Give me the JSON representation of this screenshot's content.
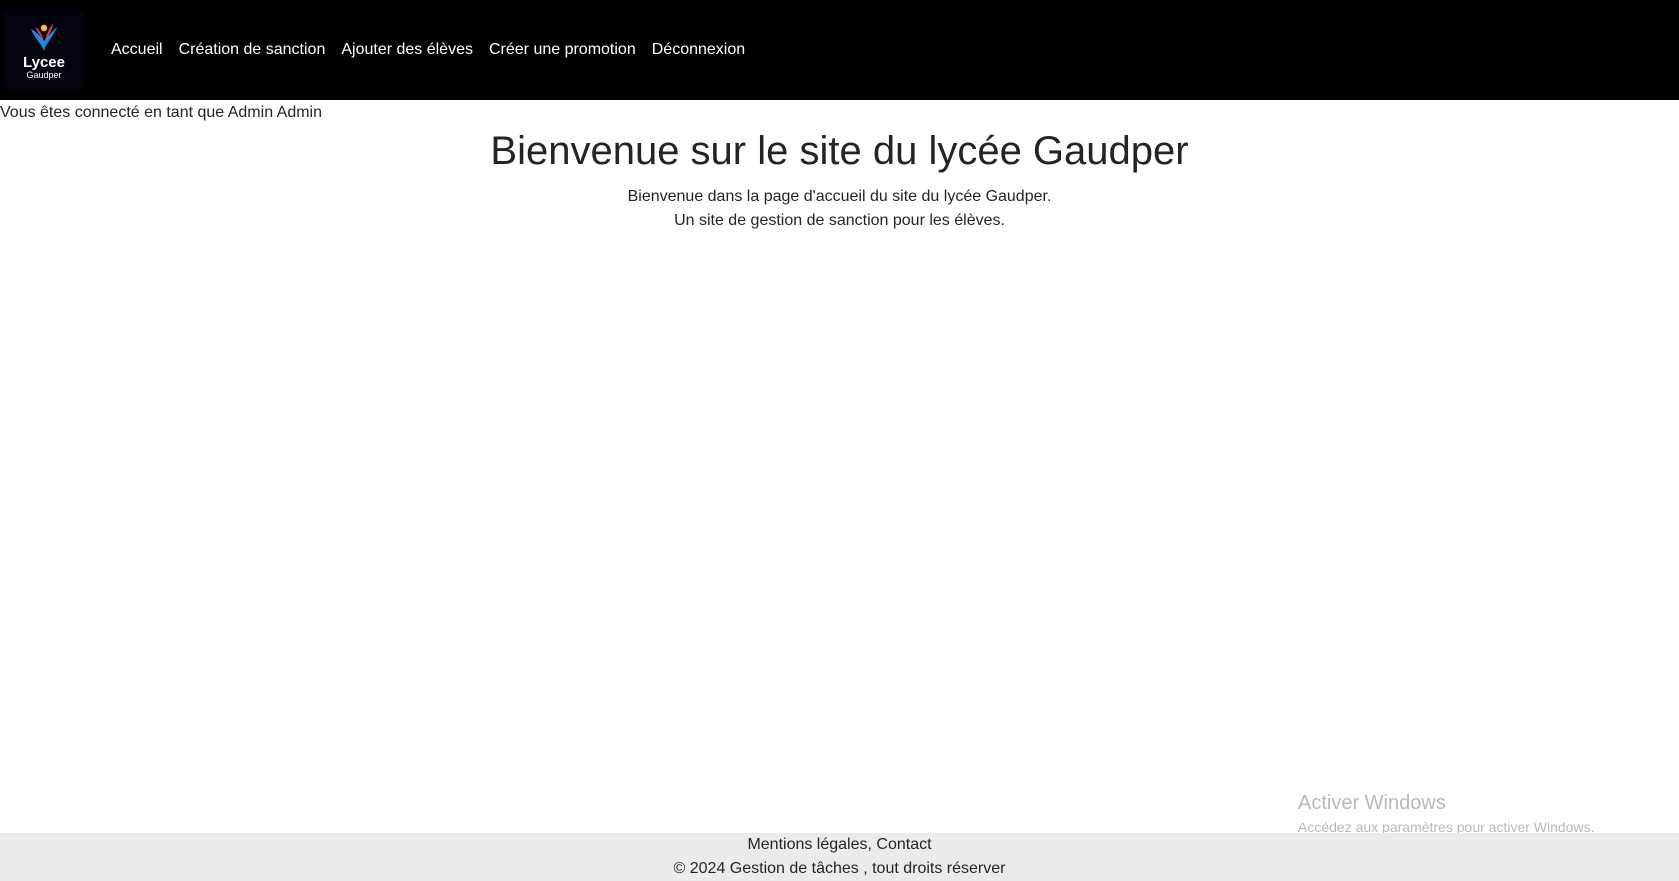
{
  "logo": {
    "line1": "Lycee",
    "line2": "Gaudper"
  },
  "nav": {
    "items": [
      {
        "label": "Accueil"
      },
      {
        "label": "Création de sanction"
      },
      {
        "label": "Ajouter des élèves"
      },
      {
        "label": "Créer une promotion"
      },
      {
        "label": "Déconnexion"
      }
    ]
  },
  "status": {
    "login_text": "Vous êtes connecté en tant que Admin Admin"
  },
  "main": {
    "title": "Bienvenue sur le site du lycée Gaudper",
    "line1": "Bienvenue dans la page d'accueil du site du lycée Gaudper.",
    "line2": "Un site de gestion de sanction pour les élèves."
  },
  "watermark": {
    "title": "Activer Windows",
    "subtitle": "Accédez aux paramètres pour activer Windows."
  },
  "footer": {
    "mentions": "Mentions légales",
    "separator": ", ",
    "contact": "Contact",
    "copyright": "© 2024 Gestion de tâches , tout droits réserver"
  },
  "colors": {
    "navbar_bg": "#000000",
    "nav_text": "#ffffff",
    "footer_bg": "#e9ecef",
    "text": "#212529"
  },
  "icons": {
    "logo": "lycee-bird-logo-icon"
  }
}
